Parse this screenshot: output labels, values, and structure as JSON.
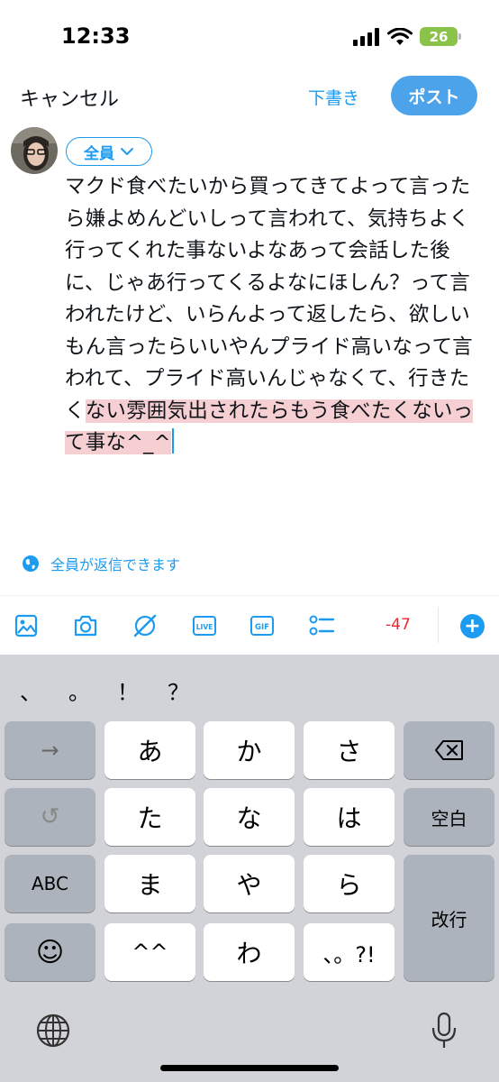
{
  "status_bar": {
    "time": "12:33",
    "battery": "26"
  },
  "header": {
    "cancel_label": "キャンセル",
    "drafts_label": "下書き",
    "post_label": "ポスト"
  },
  "audience": {
    "label": "全員"
  },
  "compose": {
    "text_within_limit": "マクド食べたいから買ってきてよって言ったら嫌よめんどいしって言われて、気持ちよく行ってくれた事ないよなあって会話した後に、じゃあ行ってくるよなにほしん？って言われたけど、いらんよって返したら、欲しいもん言ったらいいやんプライド高いなって言われて、プライド高いんじゃなくて、行きたく",
    "text_over_limit": "ない雰囲気出されたらもう食べたくないって事な^_^"
  },
  "reply_setting": {
    "label": "全員が返信できます"
  },
  "toolbar": {
    "char_count": "-47",
    "live_label": "LIVE",
    "gif_label": "GIF",
    "icons": [
      "image-icon",
      "camera-icon",
      "grok-icon",
      "live-icon",
      "gif-icon",
      "poll-icon",
      "add-icon"
    ]
  },
  "keyboard": {
    "punctuation": [
      "、",
      "。",
      "！",
      "？"
    ],
    "rows": [
      [
        "→",
        "あ",
        "か",
        "さ",
        "⌫"
      ],
      [
        "↺",
        "た",
        "な",
        "は",
        "空白"
      ],
      [
        "ABC",
        "ま",
        "や",
        "ら",
        "改行"
      ],
      [
        "☺",
        "^^",
        "わ",
        "、。?!"
      ]
    ],
    "labels": {
      "arrow": "→",
      "a": "あ",
      "ka": "か",
      "sa": "さ",
      "undo": "↺",
      "ta": "た",
      "na": "な",
      "ha": "は",
      "space": "空白",
      "abc": "ABC",
      "ma": "ま",
      "ya": "や",
      "ra": "ら",
      "return": "改行",
      "emoji": "☺",
      "kaomoji": "^^",
      "wa": "わ",
      "punct": "、。?!"
    }
  },
  "colors": {
    "accent": "#1d9bf0",
    "post_button": "#4ca3ea",
    "over_limit": "#f6cfd3",
    "count_negative": "#f4212e"
  }
}
